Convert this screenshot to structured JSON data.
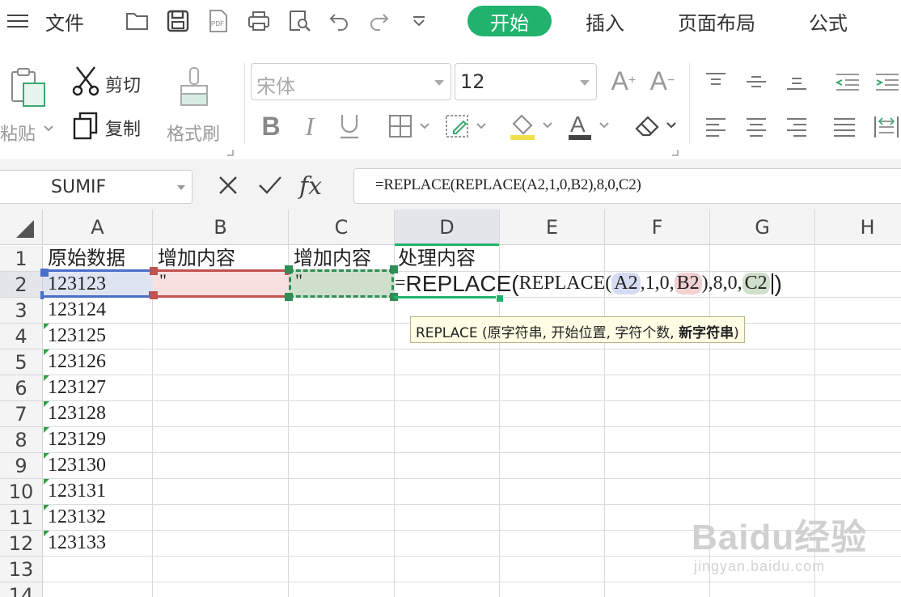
{
  "menu": {
    "file": "文件",
    "tabs": [
      {
        "label": "开始",
        "active": true
      },
      {
        "label": "插入",
        "active": false
      },
      {
        "label": "页面布局",
        "active": false
      },
      {
        "label": "公式",
        "active": false
      }
    ]
  },
  "ribbon": {
    "paste": "粘贴",
    "cut": "剪切",
    "copy": "复制",
    "format_painter": "格式刷",
    "font_name": "宋体",
    "font_size": "12"
  },
  "formula_bar": {
    "name_box": "SUMIF",
    "formula": "=REPLACE(REPLACE(A2,1,0,B2),8,0,C2)"
  },
  "sheet": {
    "columns": [
      "A",
      "B",
      "C",
      "D",
      "E",
      "F",
      "G",
      "H"
    ],
    "selected_column": "D",
    "rows": [
      "1",
      "2",
      "3",
      "4",
      "5",
      "6",
      "7",
      "8",
      "9",
      "10",
      "11",
      "12",
      "13",
      "14"
    ],
    "selected_row": "2",
    "header_row": {
      "A": "原始数据",
      "B": "增加内容",
      "C": "增加内容",
      "D": "处理内容"
    },
    "B2": "\"",
    "C2": "\"",
    "column_a_values": [
      "123123",
      "123124",
      "123125",
      "123126",
      "123127",
      "123128",
      "123129",
      "123130",
      "123131",
      "123132",
      "123133"
    ]
  },
  "edit": {
    "prefix": "=",
    "func": "REPLACE",
    "open": "(",
    "inner_open": "REPLACE(",
    "ref_a": "A2",
    "args1": ",1,0,",
    "ref_b": "B2",
    "args2": "),8,0,",
    "ref_c": "C2",
    "close": ")"
  },
  "tooltip": {
    "text": "REPLACE (原字符串, 开始位置, 字符个数, ",
    "bold": "新字符串",
    "end": ")"
  },
  "watermark": {
    "brand": "Baidu经验",
    "url": "jingyan.baidu.com"
  },
  "colors": {
    "accent": "#21b36d",
    "ref_a": "#4a6fc8",
    "ref_b": "#c0524f",
    "ref_c": "#2f8d55"
  }
}
